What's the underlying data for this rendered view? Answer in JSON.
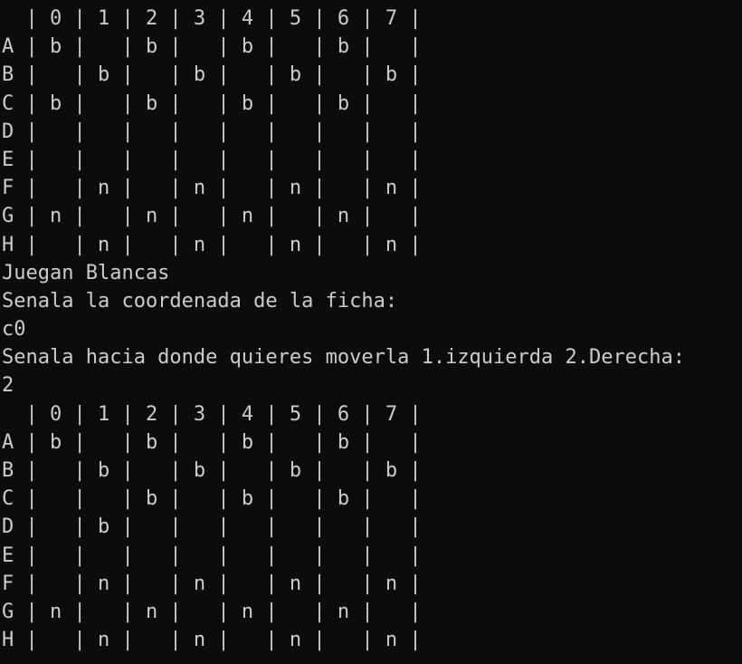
{
  "console": {
    "lines": [
      "  | 0 | 1 | 2 | 3 | 4 | 5 | 6 | 7 |",
      "A | b |   | b |   | b |   | b |   |",
      "B |   | b |   | b |   | b |   | b |",
      "C | b |   | b |   | b |   | b |   |",
      "D |   |   |   |   |   |   |   |   |",
      "E |   |   |   |   |   |   |   |   |",
      "F |   | n |   | n |   | n |   | n |",
      "G | n |   | n |   | n |   | n |   |",
      "H |   | n |   | n |   | n |   | n |",
      "Juegan Blancas",
      "Senala la coordenada de la ficha:",
      "c0",
      "Senala hacia donde quieres moverla 1.izquierda 2.Derecha:",
      "2",
      "  | 0 | 1 | 2 | 3 | 4 | 5 | 6 | 7 |",
      "A | b |   | b |   | b |   | b |   |",
      "B |   | b |   | b |   | b |   | b |",
      "C |   |   | b |   | b |   | b |   |",
      "D |   | b |   |   |   |   |   |   |",
      "E |   |   |   |   |   |   |   |   |",
      "F |   | n |   | n |   | n |   | n |",
      "G | n |   | n |   | n |   | n |   |",
      "H |   | n |   | n |   | n |   | n |"
    ]
  }
}
